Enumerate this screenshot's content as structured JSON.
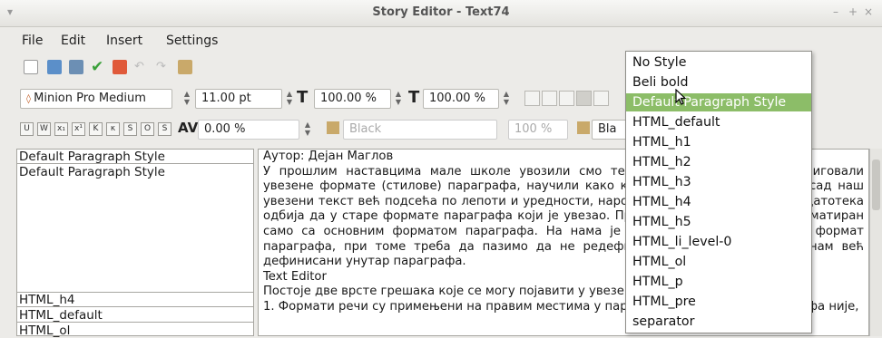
{
  "window": {
    "title": "Story Editor - Text74",
    "minimize_glyph": "–",
    "maximize_glyph": "+",
    "close_glyph": "×"
  },
  "menu": [
    {
      "label": "File"
    },
    {
      "label": "Edit"
    },
    {
      "label": "Insert"
    },
    {
      "label": "Settings"
    }
  ],
  "toolbar": {
    "icons": [
      "new-icon",
      "open-icon",
      "save-icon",
      "checkmark-icon",
      "close-doc-icon",
      "undo-icon",
      "redo-icon",
      "search-replace-icon"
    ]
  },
  "font_toolbar": {
    "font_name": "Minion Pro Medium",
    "font_size": "11.00 pt",
    "scale_h": "100.00 %",
    "scale_v": "100.00 %",
    "t_glyph": "T"
  },
  "char_toolbar": {
    "tracking": "0.00 %",
    "fill_color": "Black",
    "shade": "100 %",
    "stroke_color": "Bla",
    "av_glyph": "AV"
  },
  "paragraph_styles_panel": {
    "rows_top": [
      "Default Paragraph Style",
      "Default Paragraph Style"
    ],
    "rows_bottom": [
      "HTML_h4",
      "HTML_default",
      "HTML_ol"
    ]
  },
  "editor": {
    "paragraphs": [
      "Аутор: Дејан Маглов",
      "У прошлим наставцима мале школе увозили смо текст из HTML датотека, кориговали увезене формате (стилове) параграфа, научили како користи за увезени текст и сад наш увезени текст већ подсећа по лепоти и уредности, нарочито текст увезен из HTML датотека одбија да у старе формате параграфа који је увезао. Практично читав текст је форматиран само са основним форматом параграфа. На нама је сада да применимо прави формат параграфа, при томе треба да пазимо да не редефинишемо формате који су нам већ дефинисани унутар параграфа.",
      "Text Editor",
      "Постоје две врсте грешака које се могу појавити у увезеном тексту:",
      "1. Формати речи су примењени на правим местима у параграфу али формат параграфа није,"
    ]
  },
  "style_dropdown": {
    "selected_index": 2,
    "items": [
      "No Style",
      "Beli bold",
      "Default Paragraph Style",
      "HTML_default",
      "HTML_h1",
      "HTML_h2",
      "HTML_h3",
      "HTML_h4",
      "HTML_h5",
      "HTML_li_level-0",
      "HTML_ol",
      "HTML_p",
      "HTML_pre",
      "separator"
    ]
  },
  "colors": {
    "selection": "#8cbd68",
    "titlebar_text": "#555555"
  }
}
